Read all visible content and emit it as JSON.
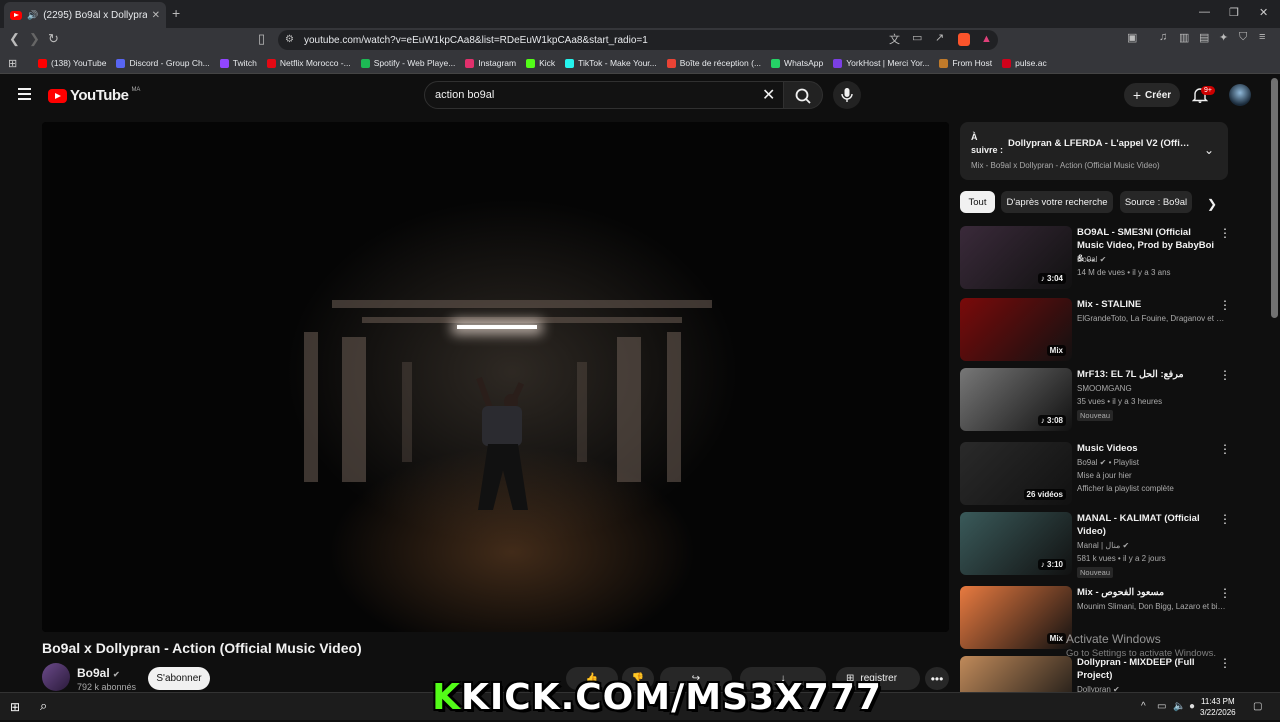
{
  "browser": {
    "tab_title": "(2295) Bo9al x Dollypran - Ac",
    "new_tab": "+",
    "url": "youtube.com/watch?v=eEuW1kpCAa8&list=RDeEuW1kpCAa8&start_radio=1",
    "bookmarks": [
      {
        "label": "(138) YouTube",
        "color": "#ff0000"
      },
      {
        "label": "Discord - Group Ch...",
        "color": "#5865f2"
      },
      {
        "label": "Twitch",
        "color": "#9146ff"
      },
      {
        "label": "Netflix Morocco -...",
        "color": "#e50914"
      },
      {
        "label": "Spotify - Web Playe...",
        "color": "#1db954"
      },
      {
        "label": "Instagram",
        "color": "#e1306c"
      },
      {
        "label": "Kick",
        "color": "#53fc18"
      },
      {
        "label": "TikTok - Make Your...",
        "color": "#25f4ee"
      },
      {
        "label": "Boîte de réception (...",
        "color": "#ea4335"
      },
      {
        "label": "WhatsApp",
        "color": "#25d366"
      },
      {
        "label": "YorkHost | Merci Yor...",
        "color": "#7b3fe4"
      },
      {
        "label": "From Host",
        "color": "#c07a2a"
      },
      {
        "label": "pulse.ac",
        "color": "#d0021b"
      }
    ]
  },
  "youtube": {
    "logo_text": "YouTube",
    "country_code": "MA",
    "search_value": "action bo9al",
    "create_label": "Créer",
    "notif_badge": "9+",
    "video_title": "Bo9al x Dollypran - Action (Official Music Video)",
    "channel_name": "Bo9al",
    "channel_subs": "792 k abonnés",
    "subscribe_label": "S'abonner",
    "save_label": "registrer",
    "more_label": "•••"
  },
  "up_next": {
    "label": "À suivre :",
    "title": "Dollypran & LFERDA - L'appel V2 (Official V...",
    "subtitle": "Mix - Bo9al x Dollypran - Action (Official Music Video)"
  },
  "chips": [
    "Tout",
    "D'après votre recherche",
    "Source : Bo9al"
  ],
  "recommendations": [
    {
      "title": "BO9AL - SME3NI (Official Music Video, Prod by BabyBoi & ...",
      "line1": "Bo9al ✔",
      "line2": "14 M de vues • il y a 3 ans",
      "badge": "",
      "duration": "♪ 3:04",
      "thumb": "#3a2a3a"
    },
    {
      "title": "Mix - STALINE",
      "line1": "ElGrandeToto, La Fouine, Draganov et bie...",
      "line2": "",
      "badge": "",
      "duration": "Mix",
      "thumb": "#7a0a0a"
    },
    {
      "title": "MrF13: EL 7L مرفع: الحل",
      "line1": "SMOOMGANG",
      "line2": "35 vues • il y a 3 heures",
      "badge": "Nouveau",
      "duration": "♪ 3:08",
      "thumb": "#777777"
    },
    {
      "title": "Music Videos",
      "line1": "Bo9al ✔ • Playlist",
      "line2": "Mise à jour hier",
      "line3": "Afficher la playlist complète",
      "badge": "",
      "duration": "26 vidéos",
      "thumb": "#2a2a2a"
    },
    {
      "title": "MANAL - KALIMAT  (Official Video)",
      "line1": "Manal | منال ✔",
      "line2": "581 k vues • il y a 2 jours",
      "badge": "Nouveau",
      "duration": "♪ 3:10",
      "thumb": "#3a5a5a"
    },
    {
      "title": "Mix - مسعود الفحوص",
      "line1": "Mounim Slimani, Don Bigg, Lazaro et bie...",
      "line2": "",
      "badge": "",
      "duration": "Mix",
      "thumb": "#e87a40"
    },
    {
      "title": "Dollypran - MIXDEEP (Full Project)",
      "line1": "Dollypran ✔",
      "line2": "",
      "badge": "",
      "duration": "",
      "thumb": "#c08a5a"
    }
  ],
  "windows": {
    "activate_title": "Activate Windows",
    "activate_sub": "Go to Settings to activate Windows.",
    "time": "11:43 PM",
    "date": "3/22/2026"
  },
  "overlay": {
    "k": "K",
    "text": "KICK.COM/MS3X777"
  }
}
